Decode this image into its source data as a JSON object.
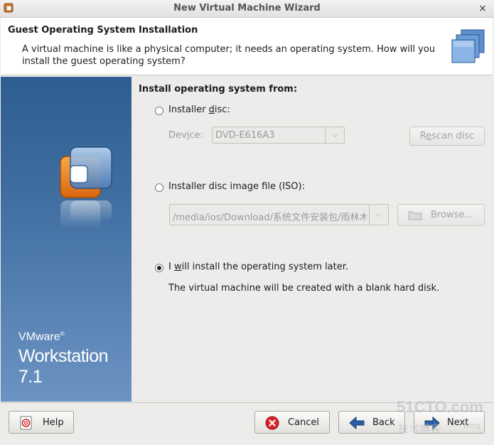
{
  "window": {
    "title": "New Virtual Machine Wizard",
    "close_glyph": "×"
  },
  "header": {
    "title": "Guest Operating System Installation",
    "description": "A virtual machine is like a physical computer; it needs an operating system. How will you install the guest operating system?"
  },
  "banner": {
    "brand": "VMware",
    "registered": "®",
    "product": "Workstation 7.1"
  },
  "install": {
    "section_label": "Install operating system from:",
    "disc_option": {
      "label_pre": "Installer ",
      "mnemonic": "d",
      "label_post": "isc:",
      "selected": false
    },
    "device_label_pre": "Dev",
    "device_mnemonic": "i",
    "device_label_post": "ce:",
    "device_value": "DVD-E616A3",
    "rescan_pre": "R",
    "rescan_mnemonic": "e",
    "rescan_post": "scan disc",
    "iso_option": {
      "label_pre": "Installer disc ima",
      "mnemonic": "g",
      "label_post": "e file (ISO):",
      "selected": false
    },
    "iso_path": "/media/ios/Download/系统文件安装包/雨林木",
    "browse_label": "Browse...",
    "later_option": {
      "label_pre": "I ",
      "mnemonic": "w",
      "label_post": "ill install the operating system later.",
      "selected": true
    },
    "later_note": "The virtual machine will be created with a blank hard disk."
  },
  "footer": {
    "help": "Help",
    "cancel": "Cancel",
    "back": "Back",
    "next": "Next"
  },
  "watermark": {
    "site": "51CTO.com",
    "sub": "技术博客",
    "blog": "Blog"
  },
  "colors": {
    "banner_top": "#2e5d91",
    "banner_bottom": "#6c93c2",
    "cancel_red": "#d8232a",
    "arrow_blue": "#2a5fa8"
  }
}
